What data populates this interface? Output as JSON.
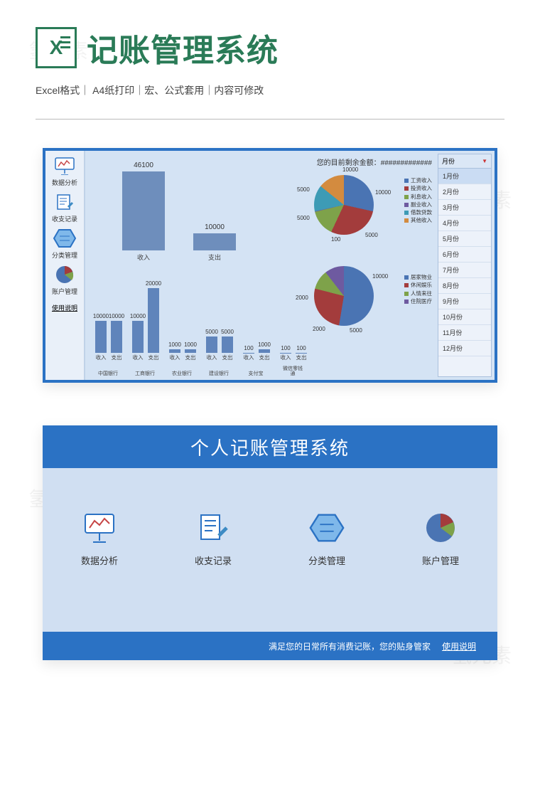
{
  "header": {
    "title": "记账管理系统",
    "subtitle": "Excel格式｜ A4纸打印｜宏、公式套用｜内容可修改"
  },
  "watermark": "氢元素",
  "panel1": {
    "balance_label": "您的目前剩余金额：",
    "balance_value": "#############",
    "sidebar": {
      "items": [
        {
          "label": "数据分析"
        },
        {
          "label": "收支记录"
        },
        {
          "label": "分类管理"
        },
        {
          "label": "账户管理"
        }
      ],
      "help": "使用说明"
    },
    "month_picker": {
      "header": "月份",
      "selected": "1月份",
      "months": [
        "1月份",
        "2月份",
        "3月份",
        "4月份",
        "5月份",
        "6月份",
        "7月份",
        "8月份",
        "9月份",
        "10月份",
        "11月份",
        "12月份"
      ]
    }
  },
  "panel2": {
    "title": "个人记账管理系统",
    "features": [
      {
        "label": "数据分析"
      },
      {
        "label": "收支记录"
      },
      {
        "label": "分类管理"
      },
      {
        "label": "账户管理"
      }
    ],
    "footer_text": "满足您的日常所有消费记账，您的贴身管家",
    "footer_link": "使用说明"
  },
  "chart_data": [
    {
      "id": "income_vs_expense",
      "type": "bar",
      "categories": [
        "收入",
        "支出"
      ],
      "values": [
        46100,
        10000
      ],
      "ylim": [
        0,
        50000
      ]
    },
    {
      "id": "accounts_breakdown",
      "type": "bar",
      "sub_categories": [
        "收入",
        "支出"
      ],
      "accounts": [
        "中国银行",
        "工商银行",
        "农业银行",
        "建设银行",
        "支付宝",
        "微信零钱通"
      ],
      "series": [
        {
          "name": "收入",
          "values": [
            10000,
            10000,
            1000,
            5000,
            100,
            100
          ]
        },
        {
          "name": "支出",
          "values": [
            10000,
            20000,
            1000,
            5000,
            1000,
            100
          ]
        }
      ],
      "ylim": [
        0,
        22000
      ]
    },
    {
      "id": "income_pie",
      "type": "pie",
      "labels": [
        "工资收入",
        "投资收入",
        "利息收入",
        "副业收入",
        "借款贷款",
        "其他收入"
      ],
      "values": [
        10000,
        10000,
        5000,
        100,
        5000,
        5000
      ],
      "colors": [
        "#4a74b3",
        "#a33c3c",
        "#7ea24a",
        "#6e5aa0",
        "#3d9bb5",
        "#d38b3f"
      ]
    },
    {
      "id": "expense_pie",
      "type": "pie",
      "labels": [
        "居家物业",
        "休闲娱乐",
        "人情来往",
        "住院医疗"
      ],
      "values": [
        10000,
        5000,
        2000,
        2000
      ],
      "colors": [
        "#4a74b3",
        "#a33c3c",
        "#7ea24a",
        "#6e5aa0"
      ]
    }
  ]
}
